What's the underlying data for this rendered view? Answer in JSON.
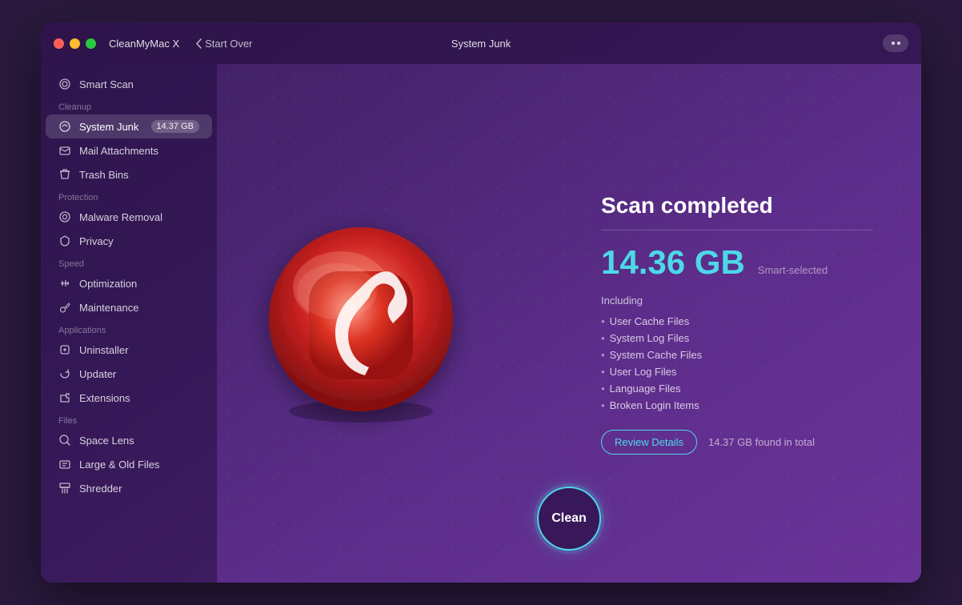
{
  "window": {
    "title": "CleanMyMac X",
    "center_title": "System Junk",
    "start_over_label": "Start Over"
  },
  "sidebar": {
    "smart_scan_label": "Smart Scan",
    "cleanup_section": "Cleanup",
    "system_junk_label": "System Junk",
    "system_junk_badge": "14.37 GB",
    "mail_attachments_label": "Mail Attachments",
    "trash_bins_label": "Trash Bins",
    "protection_section": "Protection",
    "malware_removal_label": "Malware Removal",
    "privacy_label": "Privacy",
    "speed_section": "Speed",
    "optimization_label": "Optimization",
    "maintenance_label": "Maintenance",
    "applications_section": "Applications",
    "uninstaller_label": "Uninstaller",
    "updater_label": "Updater",
    "extensions_label": "Extensions",
    "files_section": "Files",
    "space_lens_label": "Space Lens",
    "large_old_files_label": "Large & Old Files",
    "shredder_label": "Shredder"
  },
  "main": {
    "scan_completed_title": "Scan completed",
    "size_value": "14.36 GB",
    "smart_selected_label": "Smart-selected",
    "including_label": "Including",
    "file_items": [
      "User Cache Files",
      "System Log Files",
      "System Cache Files",
      "User Log Files",
      "Language Files",
      "Broken Login Items"
    ],
    "review_details_label": "Review Details",
    "found_total_label": "14.37 GB found in total",
    "clean_button_label": "Clean"
  },
  "colors": {
    "accent": "#4dd8e8",
    "close": "#ff5f57",
    "minimize": "#febc2e",
    "maximize": "#28c840"
  }
}
